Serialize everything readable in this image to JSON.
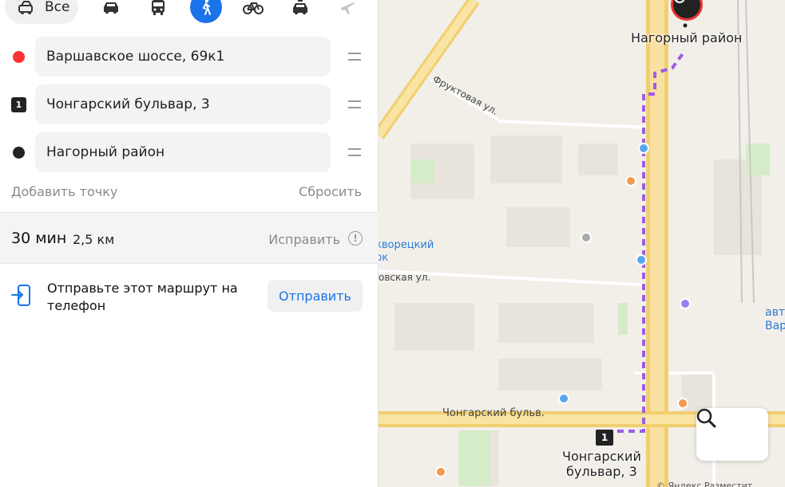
{
  "transport_modes": {
    "all_label": "Все",
    "modes": [
      {
        "icon": "car-icon"
      },
      {
        "icon": "bus-icon"
      },
      {
        "icon": "pedestrian-icon",
        "active": true
      },
      {
        "icon": "bicycle-icon"
      },
      {
        "icon": "taxi-icon"
      },
      {
        "icon": "plane-icon"
      }
    ]
  },
  "waypoints": [
    {
      "marker": "red-dot",
      "value": "Варшавское шоссе, 69к1"
    },
    {
      "marker": "1",
      "value": "Чонгарский бульвар, 3"
    },
    {
      "marker": "black-dot",
      "value": "Нагорный район"
    }
  ],
  "actions": {
    "add_point": "Добавить точку",
    "reset": "Сбросить"
  },
  "summary": {
    "time": "30 мин",
    "distance": "2,5 км",
    "fix": "Исправить",
    "info_icon": "!"
  },
  "send": {
    "text": "Отправьте этот маршрут на телефон",
    "button": "Отправить"
  },
  "map": {
    "labels": {
      "nagorny": "Нагорный район",
      "chongar_end_line1": "Чонгарский",
      "chongar_end_line2": "бульвар, 3",
      "fruit_street": "Фруктовая ул.",
      "chongar_street": "Чонгарский бульв.",
      "park_line1": "кворецкий",
      "park_line2": "рк",
      "street2": "овская ул.",
      "right_line1": "авто",
      "right_line2": "Вар",
      "copyright": "© Яндекс  Разместит"
    },
    "waypoint_marker": "1",
    "colors": {
      "route": "#9b5de5",
      "road": "#f7d77e",
      "accent": "#1a73e8"
    }
  }
}
